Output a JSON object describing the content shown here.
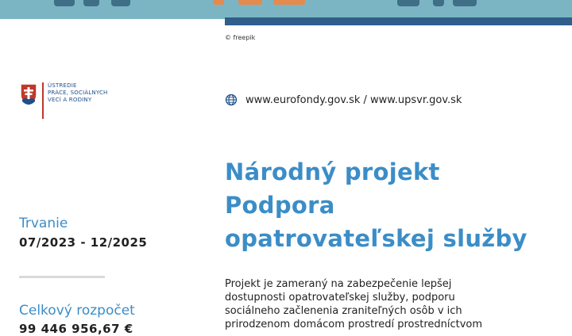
{
  "credit": "© freepik",
  "logo": {
    "lines": [
      "Ústredie",
      "práce, sociálnych",
      "vecí a rodiny"
    ]
  },
  "web": {
    "icon": "globe-icon",
    "text": "www.eurofondy.gov.sk / www.upsvr.gov.sk"
  },
  "title": {
    "lines": [
      "Národný projekt",
      "Podpora",
      "opatrovateľskej služby"
    ]
  },
  "duration": {
    "label": "Trvanie",
    "value": "07/2023 - 12/2025"
  },
  "budget": {
    "label": "Celkový rozpočet",
    "value": "99 446 956,67 €"
  },
  "description": {
    "lines": [
      "Projekt je zameraný na zabezpečenie lepšej",
      "dostupnosti opatrovateľskej služby, podporu",
      "sociálneho začlenenia zraniteľných osôb v ich",
      "prirodzenom domácom prostredí prostredníctvom"
    ]
  },
  "colors": {
    "accent": "#3b8dc7",
    "banner": "#7bb5c4",
    "flag_red": "#c0392b",
    "flag_blue": "#1f4f8a"
  }
}
